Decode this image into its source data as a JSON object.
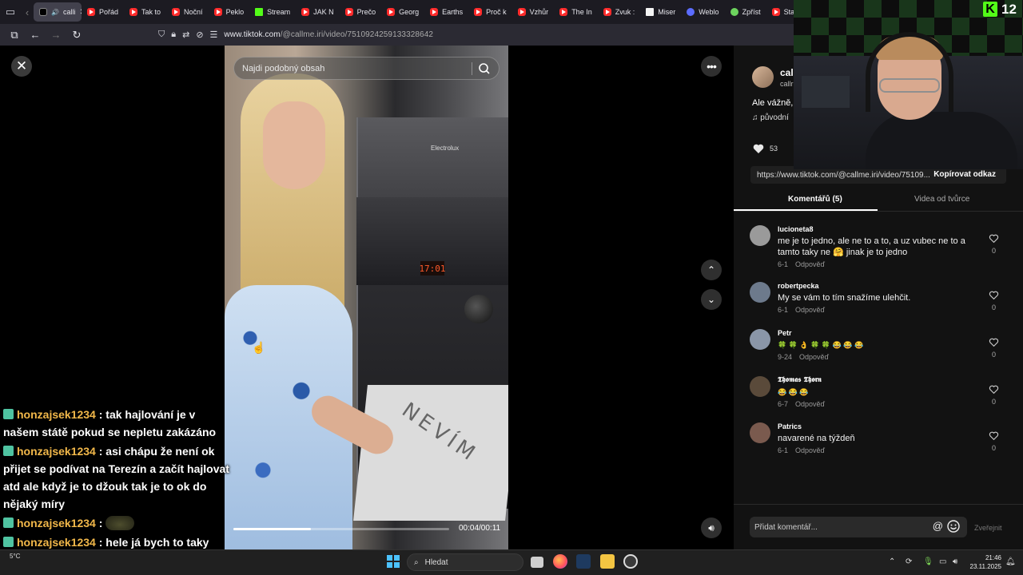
{
  "browser": {
    "active_tab": "calli",
    "tabs": [
      "Pořád",
      "Tak to",
      "Noční",
      "Peklo",
      "Stream",
      "JAK N",
      "Prečo",
      "Georg",
      "Earths",
      "Proč k",
      "Vzhůr",
      "The In",
      "Zvuk :",
      "Miser",
      "Weblo",
      "Zpříst",
      "Stanis"
    ],
    "url_host": "www.tiktok.com",
    "url_path": "/@callme.iri/video/7510924259133328642"
  },
  "video": {
    "search_placeholder": "Najdi podobný obsah",
    "progress": 0.36,
    "time_current": "00:04",
    "time_total": "00:11",
    "time_display": "00:04/00:11",
    "oven_brand": "Electrolux",
    "oven_display": "17:01",
    "tray_text": "NEVÍM"
  },
  "sidebar": {
    "author": "cal",
    "author_sub": "callr",
    "caption": "Ale vážně,",
    "music": "původní",
    "like_count": "53",
    "share_url": "https://www.tiktok.com/@callme.iri/video/75109...",
    "copy_link_label": "Kopírovat odkaz",
    "tab_comments": "Komentářů (5)",
    "tab_creator": "Videa od tvůrce",
    "comment_placeholder": "Přidat komentář...",
    "post_label": "Zveřejnit"
  },
  "comments": [
    {
      "user": "lucioneta8",
      "text": "me je to jedno, ale ne to a to, a uz vubec ne to a tamto taky ne 🤗 jinak je to jedno",
      "date": "6-1",
      "reply": "Odpověď",
      "likes": "0",
      "avatar_color": "#9a9a9a"
    },
    {
      "user": "robertpecka",
      "text": "My se vám to tím snažíme ulehčit.",
      "date": "6-1",
      "reply": "Odpověď",
      "likes": "0",
      "avatar_color": "#6d7a8c"
    },
    {
      "user": "Petr",
      "text": "🍀 🍀 👌 🍀 🍀 😂 😂 😂",
      "date": "9-24",
      "reply": "Odpověď",
      "likes": "0",
      "avatar_color": "#8a96a8"
    },
    {
      "user": "𝕿𝖍𝖔𝖒𝖆𝖘 𝕿𝖍𝖔𝖗𝖓",
      "text": "😂 😂 😂",
      "date": "6-7",
      "reply": "Odpověď",
      "likes": "0",
      "avatar_color": "#5a4a3a"
    },
    {
      "user": "Patrics",
      "text": "navarené na týždeň",
      "date": "6-1",
      "reply": "Odpověď",
      "likes": "0",
      "avatar_color": "#7a5a4e"
    }
  ],
  "stream": {
    "viewer_count": "12",
    "kick_logo": "K",
    "chat": [
      {
        "user": "honzajsek1234",
        "message": ": tak hajlování je v našem státě pokud se nepletu zakázáno"
      },
      {
        "user": "honzajsek1234",
        "message": ": asi chápu že není ok přijet se podívat na Terezín a začít hajlovat atd ale když je to džouk tak je to ok do nějaký míry"
      },
      {
        "user": "honzajsek1234",
        "message": ":"
      },
      {
        "user": "honzajsek1234",
        "message": ": hele já bych to taky nevěděl"
      }
    ]
  },
  "taskbar": {
    "search_label": "Hledat",
    "time": "21:46",
    "date": "23.11.2025",
    "weather": "5°C"
  },
  "colors": {
    "accent_kick": "#53fc18",
    "chat_name": "#f2b84a",
    "youtube_red": "#ff2b2b"
  }
}
